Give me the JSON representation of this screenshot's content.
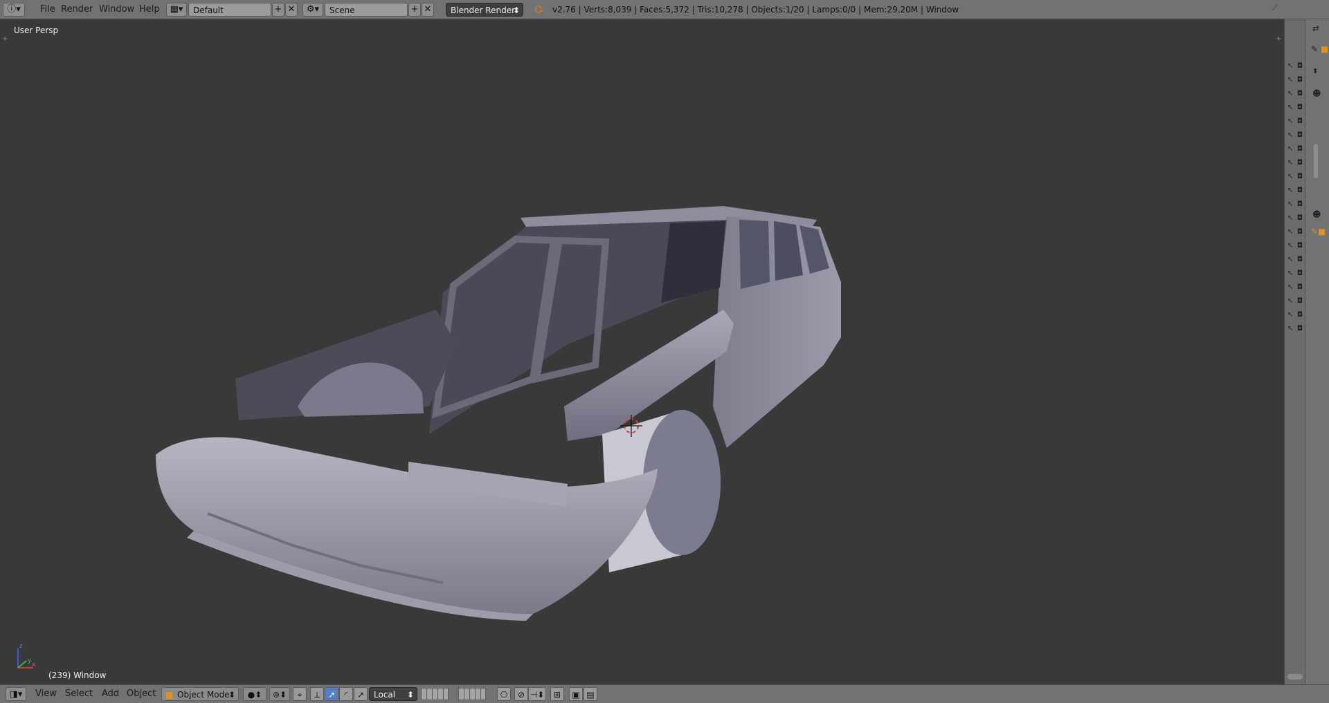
{
  "header": {
    "menus": [
      "File",
      "Render",
      "Window",
      "Help"
    ],
    "layout_name": "Default",
    "scene_name": "Scene",
    "render_engine": "Blender Render",
    "stats": "v2.76 | Verts:8,039 | Faces:5,372 | Tris:10,278 | Objects:1/20 | Lamps:0/0 | Mem:29.20M | Window"
  },
  "viewport": {
    "view_name": "User Persp",
    "frame_info": "(239) Window",
    "axis_labels": {
      "x": "x",
      "y": "y",
      "z": "z"
    }
  },
  "footer": {
    "menus": [
      "View",
      "Select",
      "Add",
      "Object"
    ],
    "mode": "Object Mode",
    "transform_orientation": "Local"
  },
  "outliner": {
    "row_count": 20
  },
  "colors": {
    "header_bg": "#727272",
    "viewport_bg": "#393939",
    "active_tool": "#5680c2",
    "mesh": "#8c8ca0"
  },
  "icons": [
    "info-icon",
    "screen-layout-icon",
    "scene-icon",
    "blender-logo-icon",
    "view3d-editor-icon",
    "cursor-arrow-icon",
    "camera-render-icon",
    "wrench-icon",
    "object-icon"
  ]
}
